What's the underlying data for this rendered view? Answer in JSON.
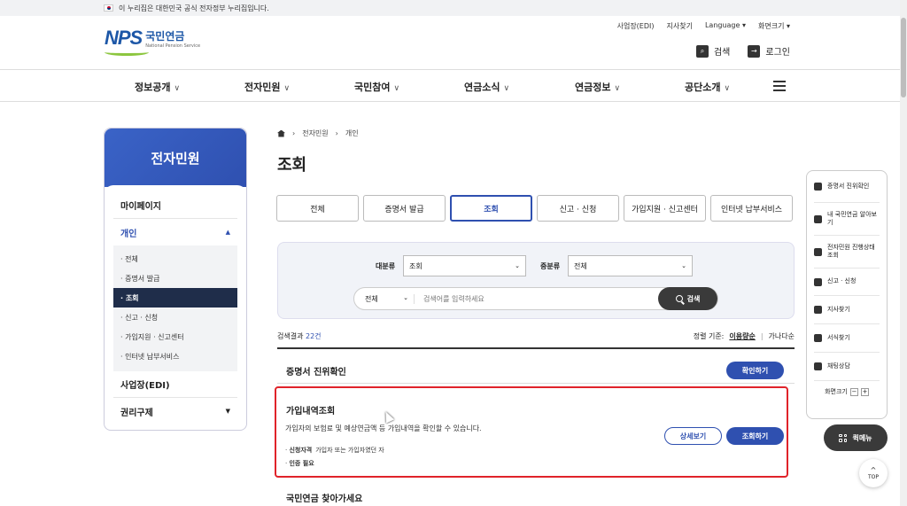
{
  "gov_banner": {
    "text": "이 누리집은 대한민국 공식 전자정부 누리집입니다."
  },
  "header": {
    "logo_mark": "NPS",
    "logo_ko": "국민연금",
    "logo_en": "National Pension Service",
    "util_links": [
      "사업장(EDI)",
      "지사찾기",
      "Language ▾",
      "화면크기 ▾"
    ],
    "search_label": "검색",
    "login_label": "로그인"
  },
  "gnb": [
    "정보공개",
    "전자민원",
    "국민참여",
    "연금소식",
    "연금정보",
    "공단소개"
  ],
  "lnb": {
    "title": "전자민원",
    "mypage": "마이페이지",
    "individual": "개인",
    "sub": [
      "· 전체",
      "· 증명서 발급",
      "· 조회",
      "· 신고 · 신청",
      "· 가입지원 · 신고센터",
      "· 인터넷 납부서비스"
    ],
    "workplace": "사업장(EDI)",
    "rights": "권리구제"
  },
  "breadcrumb": [
    "전자민원",
    "개인"
  ],
  "page_title": "조회",
  "tabs": [
    "전체",
    "증명서 발급",
    "조회",
    "신고 · 신청",
    "가입지원 · 신고센터",
    "인터넷 납부서비스"
  ],
  "search": {
    "major_label": "대분류",
    "major_value": "조회",
    "minor_label": "중분류",
    "minor_value": "전체",
    "scope": "전체",
    "placeholder": "검색어를 입력하세요",
    "button": "검색"
  },
  "results": {
    "count_prefix": "검색결과",
    "count": "22건",
    "sort_label": "정렬 기준:",
    "sort_usage": "이용량순",
    "sort_alpha": "가나다순"
  },
  "items": [
    {
      "title": "증명서 진위확인",
      "button": "확인하기"
    },
    {
      "title": "가입내역조회",
      "desc": "가입자의 보험료 및 예상연금액 등 가입내역을 확인할 수 있습니다.",
      "eligibility_label": "신청자격",
      "eligibility": "가입자 또는 가입자였던 자",
      "auth": "인증 필요",
      "detail_button": "상세보기",
      "query_button": "조회하기"
    },
    {
      "title": "국민연금 찾아가세요"
    }
  ],
  "quick_menu": {
    "items": [
      "증명서 진위확인",
      "내 국민연금 알아보기",
      "전자민원 진행상태조회",
      "신고 · 신청",
      "지사찾기",
      "서식찾기",
      "채팅상담"
    ],
    "font_size_label": "화면크기",
    "minus": "−",
    "plus": "+",
    "menu_button": "퀵메뉴",
    "top": "TOP"
  }
}
